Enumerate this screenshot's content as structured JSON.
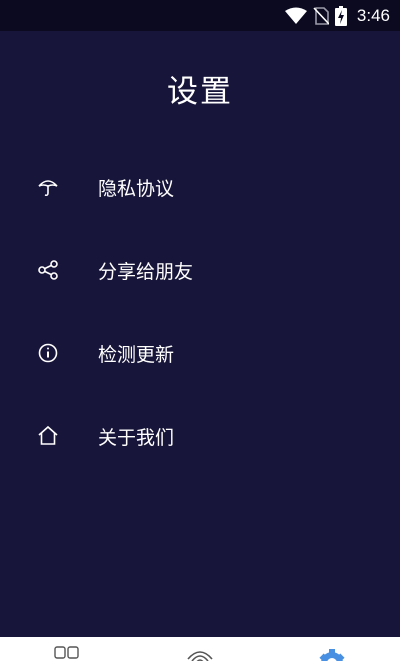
{
  "status_bar": {
    "time": "3:46"
  },
  "page": {
    "title": "设置"
  },
  "menu": [
    {
      "label": "隐私协议",
      "icon": "umbrella-icon"
    },
    {
      "label": "分享给朋友",
      "icon": "share-icon"
    },
    {
      "label": "检测更新",
      "icon": "info-icon"
    },
    {
      "label": "关于我们",
      "icon": "home-icon"
    }
  ],
  "bottom_nav": [
    {
      "icon": "grid-icon",
      "active": false
    },
    {
      "icon": "wifi-icon",
      "active": false
    },
    {
      "icon": "gear-icon",
      "active": true
    }
  ],
  "colors": {
    "background": "#171539",
    "status_bar": "#0b0a21",
    "text": "#ffffff",
    "accent": "#4a90e2"
  }
}
